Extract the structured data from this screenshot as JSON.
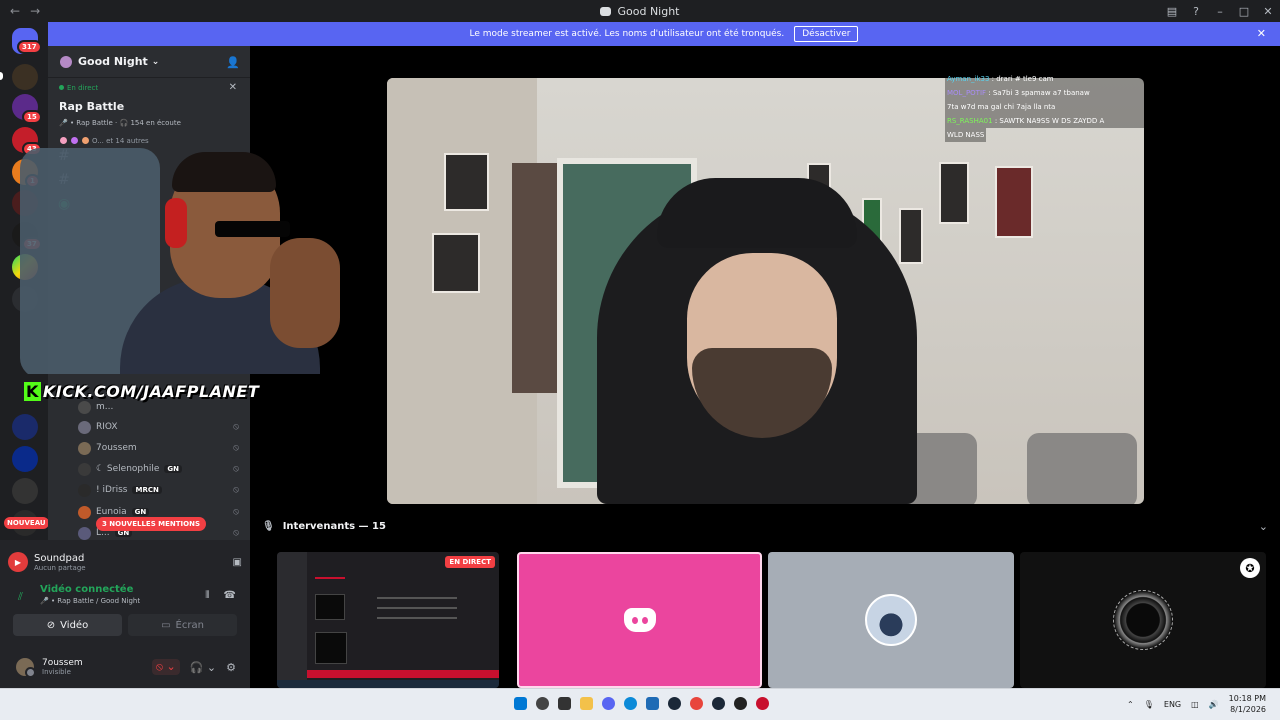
{
  "window": {
    "title": "Good Night"
  },
  "banner": {
    "text": "Le mode streamer est activé. Les noms d'utilisateur ont été tronqués.",
    "button": "Désactiver"
  },
  "servers": {
    "badges": [
      "317",
      "15",
      "43",
      "1",
      "37"
    ],
    "nouveau": "NOUVEAU"
  },
  "server": {
    "name": "Good Night"
  },
  "stage": {
    "live_label": "En direct",
    "title": "Rap Battle",
    "subtitle_prefix": "🎤 • Rap Battle",
    "listeners": "154 en écoute",
    "audience": "O... et 14 autres"
  },
  "members": [
    {
      "name": "m...",
      "tag": ""
    },
    {
      "name": "RIOX",
      "tag": ""
    },
    {
      "name": "7oussem",
      "tag": ""
    },
    {
      "name": "☾ Selenophile",
      "tag": "GN"
    },
    {
      "name": "! iDriss",
      "tag": "MRCN"
    },
    {
      "name": "Eunoia",
      "tag": "GN"
    },
    {
      "name": "L...",
      "tag": "GN"
    }
  ],
  "mentions": "3 NOUVELLES MENTIONS",
  "soundpad": {
    "name": "Soundpad",
    "sub": "Aucun partage"
  },
  "voice": {
    "status": "Vidéo connectée",
    "channel": "🎤 • Rap Battle / Good Night"
  },
  "video_buttons": {
    "video": "Vidéo",
    "screen": "Écran"
  },
  "user": {
    "name": "7oussem",
    "status": "Invisible"
  },
  "overlay": {
    "kick": "KICK.COM/JAAFPLANET"
  },
  "chat": [
    {
      "user": "Ayman_ik33",
      "msg": ": drari # tle9 cam"
    },
    {
      "user": "MOL_POTIF",
      "msg": ": Sa7bi 3 spamaw a7 tbanaw"
    },
    {
      "user": "",
      "msg": "7ta w7d ma gal chi 7aja lla nta"
    },
    {
      "user": "RS_RASHA01",
      "msg": ": SAWTK NA9SS W DS ZAYDD A"
    },
    {
      "user": "",
      "msg": "WLD NASS"
    }
  ],
  "speakers": {
    "label": "Intervenants — 15"
  },
  "tiles": {
    "live_badge": "EN DIRECT"
  },
  "taskbar": {
    "lang": "ENG",
    "time": "10:18 PM",
    "date": "8/1/2026"
  },
  "colors": {
    "accent": "#5865f2",
    "live": "#23a55a",
    "danger": "#f23f43",
    "kick": "#53fc18"
  }
}
